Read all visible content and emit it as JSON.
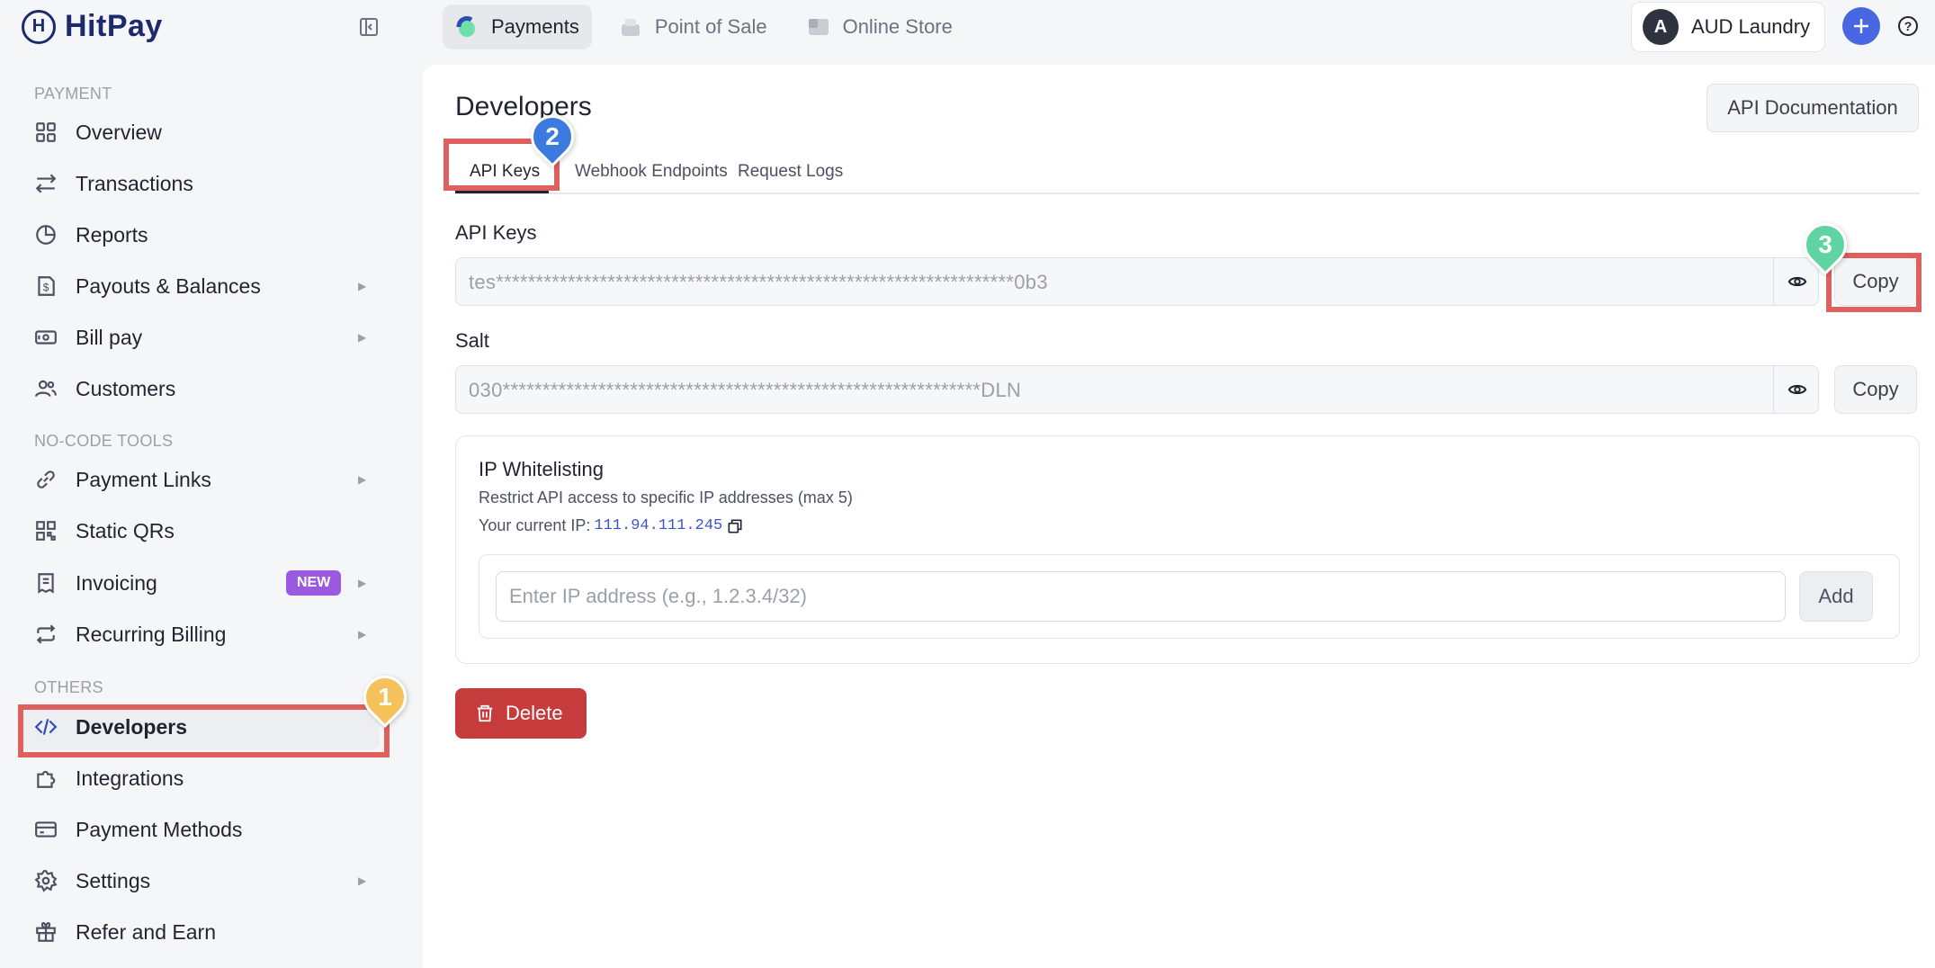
{
  "brand": {
    "name": "HitPay",
    "mark": "H"
  },
  "top_tabs": [
    {
      "label": "Payments",
      "icon": "payments-icon"
    },
    {
      "label": "Point of Sale",
      "icon": "pos-icon"
    },
    {
      "label": "Online Store",
      "icon": "store-icon"
    }
  ],
  "account": {
    "initial": "A",
    "name": "AUD Laundry"
  },
  "sidebar": {
    "sections": {
      "payment": "PAYMENT",
      "nocode": "NO-CODE TOOLS",
      "others": "OTHERS"
    },
    "items": [
      {
        "label": "Overview",
        "icon": "grid-icon"
      },
      {
        "label": "Transactions",
        "icon": "arrows-icon"
      },
      {
        "label": "Reports",
        "icon": "pie-icon"
      },
      {
        "label": "Payouts & Balances",
        "icon": "dollar-doc-icon"
      },
      {
        "label": "Bill pay",
        "icon": "cash-icon"
      },
      {
        "label": "Customers",
        "icon": "users-icon"
      },
      {
        "label": "Payment Links",
        "icon": "link-icon"
      },
      {
        "label": "Static QRs",
        "icon": "qr-icon"
      },
      {
        "label": "Invoicing",
        "icon": "invoice-icon",
        "badge": "NEW"
      },
      {
        "label": "Recurring Billing",
        "icon": "repeat-icon"
      },
      {
        "label": "Developers",
        "icon": "code-icon"
      },
      {
        "label": "Integrations",
        "icon": "puzzle-icon"
      },
      {
        "label": "Payment Methods",
        "icon": "card-icon"
      },
      {
        "label": "Settings",
        "icon": "gear-icon"
      },
      {
        "label": "Refer and Earn",
        "icon": "gift-icon"
      }
    ]
  },
  "page": {
    "title": "Developers",
    "doc_button": "API Documentation",
    "tabs": [
      "API Keys",
      "Webhook Endpoints",
      "Request Logs"
    ],
    "api_keys_label": "API Keys",
    "api_key_value": "tes*****************************************************************0b3",
    "salt_label": "Salt",
    "salt_value": "030************************************************************DLN",
    "copy_label": "Copy",
    "ip": {
      "title": "IP Whitelisting",
      "description": "Restrict API access to specific IP addresses (max 5)",
      "current_label": "Your current IP:",
      "current_value": "111.94.111.245",
      "input_placeholder": "Enter IP address (e.g., 1.2.3.4/32)",
      "add_label": "Add"
    },
    "delete_label": "Delete"
  },
  "annotations": [
    {
      "number": "1",
      "color": "#f5c15a"
    },
    {
      "number": "2",
      "color": "#3d7ae0"
    },
    {
      "number": "3",
      "color": "#5fd3a3"
    }
  ]
}
